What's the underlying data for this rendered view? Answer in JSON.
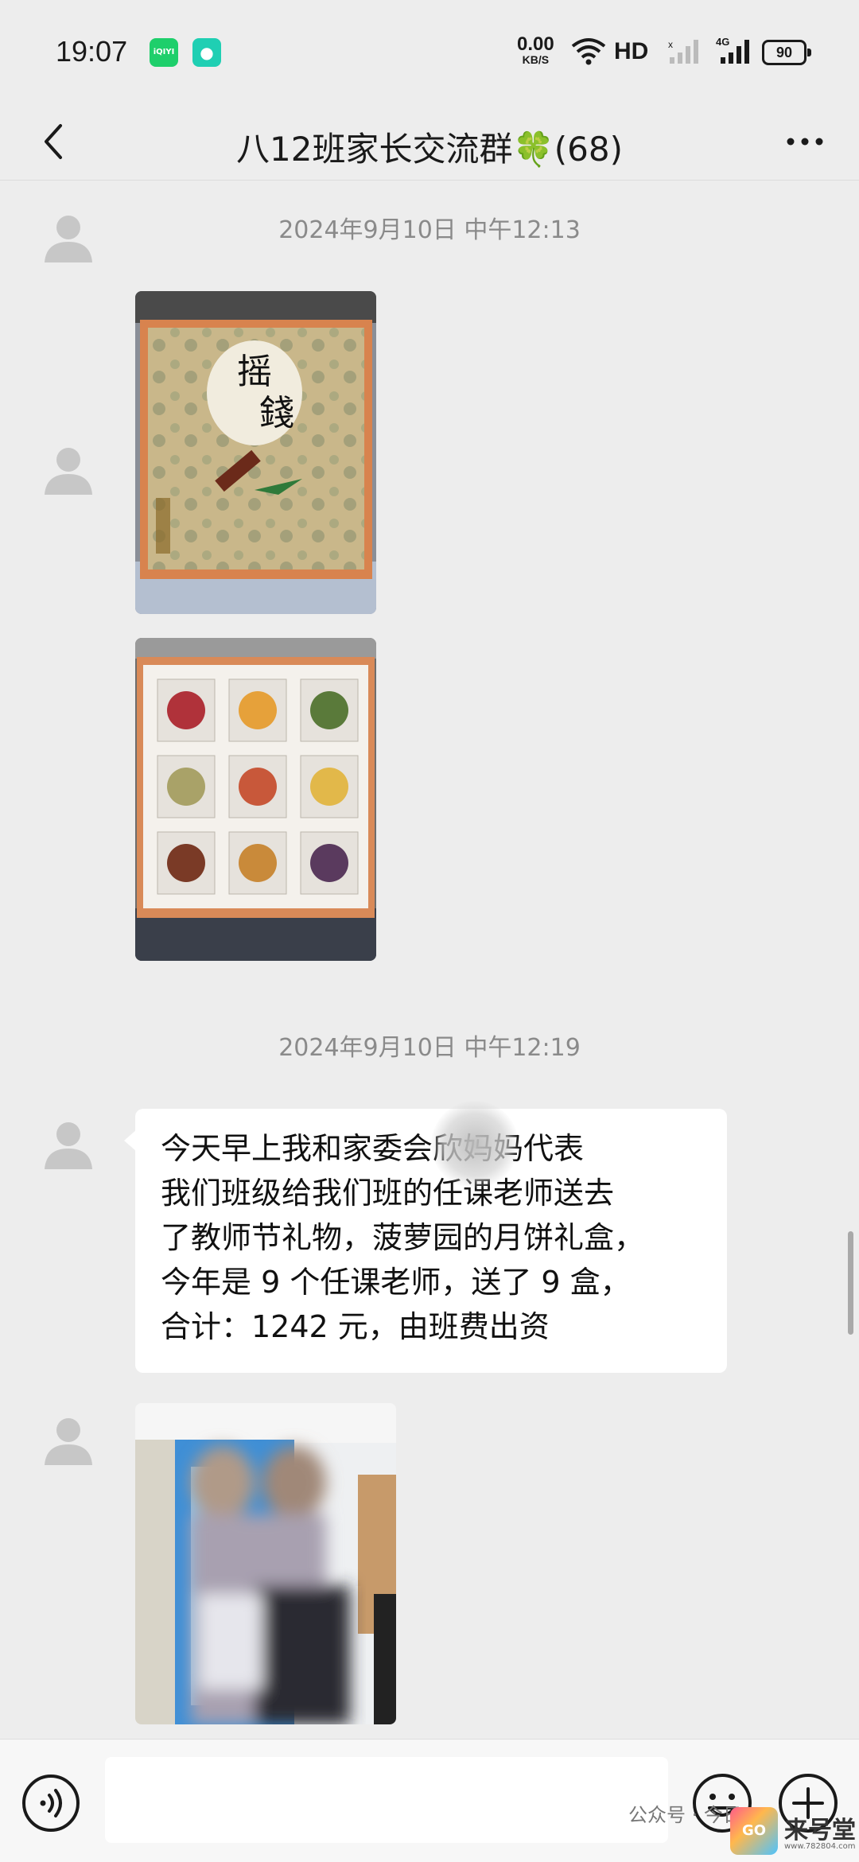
{
  "status_bar": {
    "time": "19:07",
    "app_badges": [
      "iQIYI",
      "msg"
    ],
    "net_speed_value": "0.00",
    "net_speed_unit": "KB/S",
    "network": "HD",
    "signal_label": "4G",
    "battery": "90"
  },
  "header": {
    "title": "八12班家长交流群🍀(68)"
  },
  "chat": {
    "timestamp_1": "2024年9月10日 中午12:13",
    "timestamp_2": "2024年9月10日 中午12:19",
    "photo_1_caption": "摇錢",
    "text_message": "今天早上我和家委会欣妈妈代表\n我们班级给我们班的任课老师送去\n了教师节礼物，菠萝园的月饼礼盒，\n今年是 9 个任课老师，送了 9 盒，\n合计：1242 元，由班费出资"
  },
  "mooncakes": {
    "colors": [
      "#b0323a",
      "#e6a13a",
      "#5a7a3a",
      "#a9a268",
      "#c8583a",
      "#e2b84a",
      "#7a3a26",
      "#c98a3a",
      "#5a3a5e"
    ]
  },
  "input_bar": {
    "placeholder": ""
  },
  "watermark": {
    "text": "公众号 · 今日",
    "logo_text": "GO",
    "brand": "来号堂",
    "url": "www.782804.com"
  },
  "icons": {
    "back": "chevron-left-icon",
    "more": "more-dots-icon",
    "voice": "voice-icon",
    "emoji": "emoji-icon",
    "plus": "plus-icon",
    "avatar": "default-avatar-icon"
  }
}
